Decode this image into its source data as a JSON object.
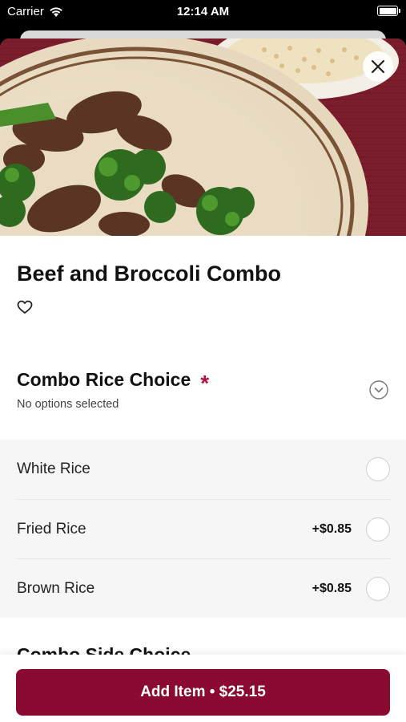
{
  "status_bar": {
    "carrier": "Carrier",
    "time": "12:14 AM"
  },
  "item": {
    "name": "Beef and Broccoli Combo"
  },
  "section": {
    "title": "Combo Rice Choice",
    "required_marker": "*",
    "subtitle": "No options selected",
    "options": [
      {
        "label": "White Rice",
        "price": ""
      },
      {
        "label": "Fried Rice",
        "price": "+$0.85"
      },
      {
        "label": "Brown Rice",
        "price": "+$0.85"
      }
    ]
  },
  "next_section": {
    "title": "Combo Side Choice"
  },
  "footer": {
    "add_button": "Add Item • $25.15"
  },
  "colors": {
    "accent": "#8a0a32",
    "required": "#b5123f"
  }
}
